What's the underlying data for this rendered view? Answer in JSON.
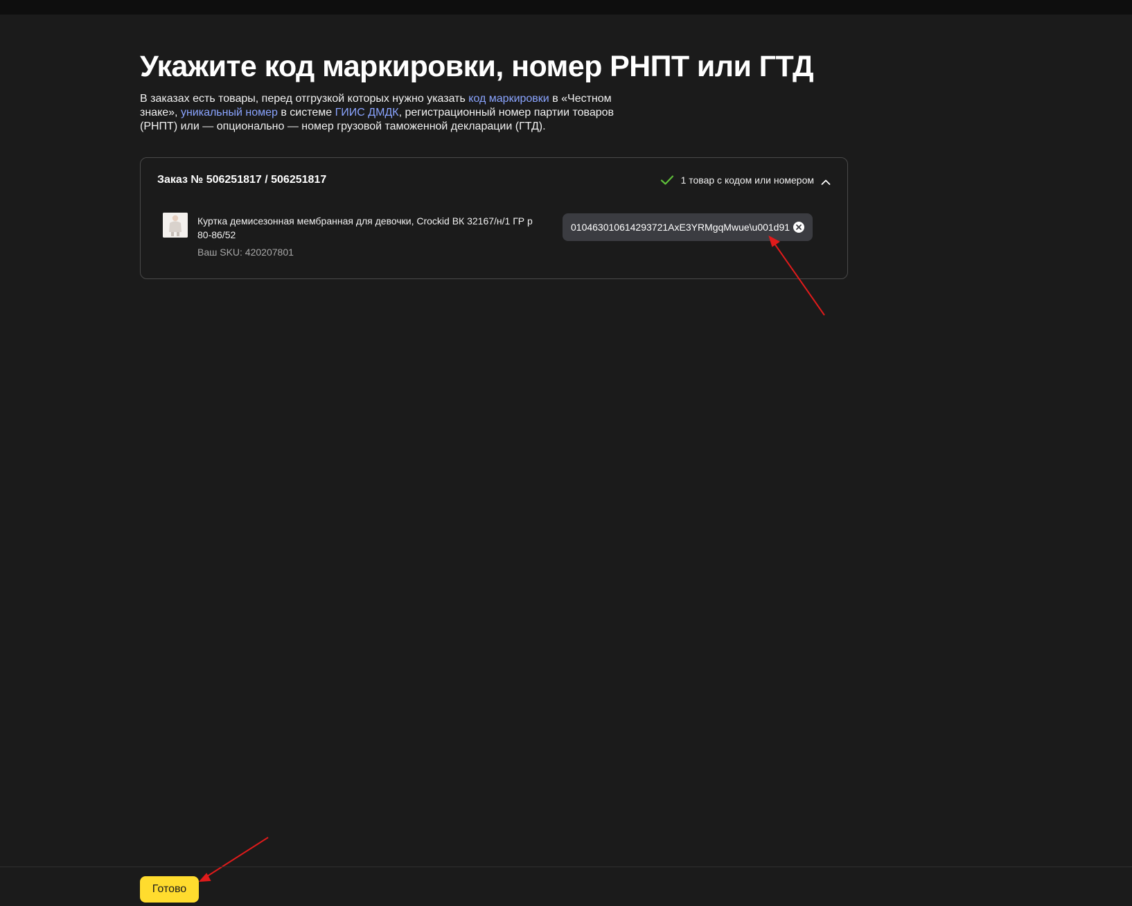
{
  "page": {
    "title": "Укажите код маркировки, номер РНПТ или ГТД",
    "intro": {
      "t1": "В заказах есть товары, перед отгрузкой которых нужно указать ",
      "link1": "код маркировки",
      "t2": " в «Честном знаке», ",
      "link2": "уникальный номер",
      "t3": " в системе ",
      "link3": "ГИИС ДМДК",
      "t4": ", регистрационный номер партии товаров (РНПТ) или — опционально — номер грузовой таможенной декларации (ГТД)."
    }
  },
  "order": {
    "title": "Заказ № 506251817 / 506251817",
    "status": "1 товар с кодом или номером",
    "status_icon": "check-icon",
    "toggle_icon": "chevron-up-icon",
    "item": {
      "name": "Куртка демисезонная мембранная для девочки, Crockid ВК 32167/н/1 ГР р 80-86/52",
      "sku": "Ваш SKU: 420207801",
      "code": "010463010614293721AxE3YRMgqMwue\\u001d91",
      "clear_icon": "close-circle-icon"
    }
  },
  "footer": {
    "done_label": "Готово"
  },
  "colors": {
    "background": "#1b1b1b",
    "link": "#8aa4ff",
    "accent_button": "#ffdc2e",
    "chip": "#3b3c41",
    "check": "#5fbf3a",
    "annotation_arrow": "#e01b1b"
  }
}
